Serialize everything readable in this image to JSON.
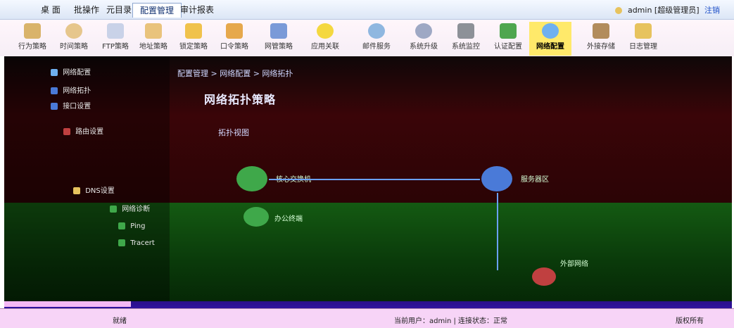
{
  "menubar": {
    "items": [
      {
        "label": "桌 面",
        "active": false
      },
      {
        "label": "批操作",
        "active": false
      },
      {
        "label": "元目录",
        "active": false
      },
      {
        "label": "配置管理",
        "active": true
      },
      {
        "label": "审计报表",
        "active": false
      }
    ],
    "user": "admin [超级管理员]",
    "logout": "注销"
  },
  "ribbon": {
    "items": [
      {
        "label": "行为策略",
        "icon": "behavior-policy-icon",
        "color": "#d9b36a",
        "highlight": false
      },
      {
        "label": "时间策略",
        "icon": "clock-icon",
        "color": "#e6c68c",
        "highlight": false
      },
      {
        "label": "FTP策略",
        "icon": "ftp-icon",
        "color": "#c9d2e8",
        "highlight": false
      },
      {
        "label": "地址策略",
        "icon": "address-book-icon",
        "color": "#e9c37c",
        "highlight": false
      },
      {
        "label": "锁定策略",
        "icon": "lock-icon",
        "color": "#f0c24c",
        "highlight": false
      },
      {
        "label": "口令策略",
        "icon": "key-icon",
        "color": "#e6a84c",
        "highlight": false
      },
      {
        "label": "网管策略",
        "icon": "network-policy-icon",
        "color": "#7a9ad8",
        "highlight": false
      },
      {
        "label": "应用关联",
        "icon": "application-icon",
        "color": "#f4d840",
        "highlight": false
      },
      {
        "label": "邮件服务",
        "icon": "mail-icon",
        "color": "#8fb7e0",
        "highlight": false
      },
      {
        "label": "系统升级",
        "icon": "upgrade-icon",
        "color": "#9ea8c4",
        "highlight": false
      },
      {
        "label": "系统监控",
        "icon": "monitor-icon",
        "color": "#8d9198",
        "highlight": false
      },
      {
        "label": "认证配置",
        "icon": "abc-check-icon",
        "color": "#4fa64f",
        "highlight": false
      },
      {
        "label": "网络配置",
        "icon": "network-config-icon",
        "color": "#6fb0f0",
        "highlight": true
      },
      {
        "label": "外接存储",
        "icon": "storage-icon",
        "color": "#b28c5c",
        "highlight": false
      },
      {
        "label": "日志管理",
        "icon": "log-icon",
        "color": "#e7c35e",
        "highlight": false
      }
    ]
  },
  "sidebar": {
    "items": [
      {
        "label": "网络配置"
      },
      {
        "label": "网络拓扑"
      },
      {
        "label": "接口设置"
      },
      {
        "label": "路由设置"
      },
      {
        "label": "DNS设置"
      },
      {
        "label": "网络诊断"
      },
      {
        "label": "Ping"
      },
      {
        "label": "Tracert"
      }
    ]
  },
  "main": {
    "breadcrumb": "配置管理 > 网络配置 > 网络拓扑",
    "title": "网络拓扑策略",
    "subtitle": "拓扑视图",
    "nodes": [
      {
        "label": "核心交换机",
        "color": "#3fa84a"
      },
      {
        "label": "服务器区",
        "color": "#4a7ad8"
      },
      {
        "label": "办公终端",
        "color": "#3fa84a"
      },
      {
        "label": "外部网络",
        "color": "#c04040"
      }
    ]
  },
  "status": {
    "left": "就绪",
    "center": "当前用户：admin  |  连接状态：正常",
    "right": "版权所有"
  }
}
